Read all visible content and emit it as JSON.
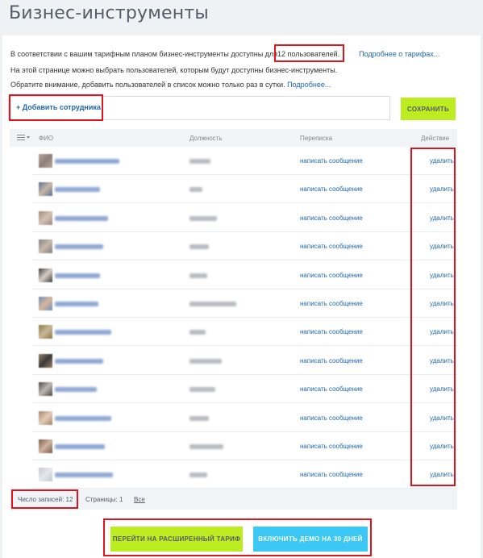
{
  "page": {
    "title": "Бизнес-инструменты"
  },
  "info": {
    "line1_prefix": "В соответствии с вашим тарифным планом бизнес-инструменты доступны для",
    "line1_count": "12 пользователей.",
    "line1_link": "Подробнее о тарифах...",
    "line2": "На этой странице можно выбрать пользователей, которым будут доступны бизнес-инструменты.",
    "line3": "Обратите внимание, добавить пользователей в список можно только раз в сутки.",
    "line3_link": "Подробнее..."
  },
  "toolbar": {
    "add_employee": "+ Добавить сотрудника",
    "save": "СОХРАНИТЬ"
  },
  "table": {
    "columns": [
      "ФИО",
      "Должность",
      "Переписка",
      "Действие"
    ],
    "rows": [
      {
        "message": "написать сообщение",
        "action": "удалить",
        "avatar_colors": [
          "#b8a49c",
          "#8f7f7a"
        ]
      },
      {
        "message": "написать сообщение",
        "action": "удалить",
        "avatar_colors": [
          "#5a6f9a",
          "#c8b7a3"
        ]
      },
      {
        "message": "написать сообщение",
        "action": "удалить",
        "avatar_colors": [
          "#a08a7c",
          "#d2c2b4"
        ]
      },
      {
        "message": "написать сообщение",
        "action": "удалить",
        "avatar_colors": [
          "#7d7f82",
          "#c9b8aa"
        ]
      },
      {
        "message": "написать сообщение",
        "action": "удалить",
        "avatar_colors": [
          "#3d3b3f",
          "#d7cfc8"
        ]
      },
      {
        "message": "написать сообщение",
        "action": "удалить",
        "avatar_colors": [
          "#6c8fc2",
          "#d9b59a"
        ]
      },
      {
        "message": "написать сообщение",
        "action": "удалить",
        "avatar_colors": [
          "#8c7a3f",
          "#c8b79a"
        ]
      },
      {
        "message": "написать сообщение",
        "action": "удалить",
        "avatar_colors": [
          "#9a7e66",
          "#3a3a3a"
        ]
      },
      {
        "message": "написать сообщение",
        "action": "удалить",
        "avatar_colors": [
          "#4a4647",
          "#c0b8b2"
        ]
      },
      {
        "message": "написать сообщение",
        "action": "удалить",
        "avatar_colors": [
          "#a4826a",
          "#e2cdb8"
        ]
      },
      {
        "message": "написать сообщение",
        "action": "удалить",
        "avatar_colors": [
          "#7a5b47",
          "#cfb49e"
        ]
      },
      {
        "message": "написать сообщение",
        "action": "удалить",
        "avatar_colors": [
          "#c2c7cc",
          "#e6e9ec"
        ]
      }
    ]
  },
  "footer": {
    "count": "Число записей: 12",
    "pages": "Страницы: 1",
    "all": "Все"
  },
  "actions": {
    "upgrade": "ПЕРЕЙТИ НА РАСШИРЕННЫЙ ТАРИФ",
    "demo": "ВКЛЮЧИТЬ ДЕМО НА 30 ДНЕЙ"
  },
  "colors": {
    "accent_green": "#bbed21",
    "accent_blue": "#3bc8f5",
    "link": "#2067b0",
    "highlight": "#e0141e"
  }
}
